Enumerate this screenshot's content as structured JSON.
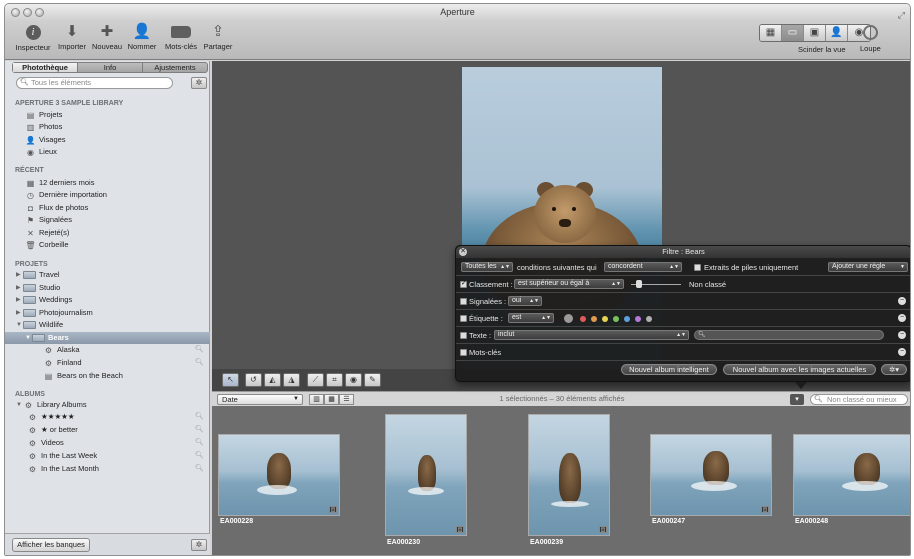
{
  "window": {
    "title": "Aperture"
  },
  "toolbar": {
    "items": [
      {
        "label": "Inspecteur",
        "icon": "info-icon"
      },
      {
        "label": "Importer",
        "icon": "import-arrow-icon"
      },
      {
        "label": "Nouveau",
        "icon": "plus-icon"
      },
      {
        "label": "Nommer",
        "icon": "person-icon"
      },
      {
        "label": "Mots-clés",
        "icon": "tag-icon"
      },
      {
        "label": "Partager",
        "icon": "share-icon"
      }
    ],
    "view_label": "Scinder la vue",
    "loupe_label": "Loupe"
  },
  "sidebar": {
    "tabs": [
      "Photothèque",
      "Info",
      "Ajustements"
    ],
    "active_tab": "Photothèque",
    "search_placeholder": "Tous les éléments",
    "library_header": "APERTURE 3 SAMPLE LIBRARY",
    "library_items": [
      {
        "label": "Projets",
        "icon": "projects-icon"
      },
      {
        "label": "Photos",
        "icon": "photos-icon"
      },
      {
        "label": "Visages",
        "icon": "faces-icon"
      },
      {
        "label": "Lieux",
        "icon": "places-icon"
      }
    ],
    "recent_header": "RÉCENT",
    "recent_items": [
      {
        "label": "12 derniers mois",
        "icon": "calendar-icon"
      },
      {
        "label": "Dernière importation",
        "icon": "clock-icon"
      },
      {
        "label": "Flux de photos",
        "icon": "photostream-icon"
      },
      {
        "label": "Signalées",
        "icon": "flag-icon"
      },
      {
        "label": "Rejeté(s)",
        "icon": "x-icon"
      },
      {
        "label": "Corbeille",
        "icon": "trash-icon"
      }
    ],
    "projects_header": "PROJETS",
    "projects": [
      "Travel",
      "Studio",
      "Weddings",
      "Photojournalism",
      "Wildlife"
    ],
    "selected_project": "Bears",
    "sub_items": [
      {
        "label": "Alaska",
        "icon": "smart-album-icon"
      },
      {
        "label": "Finland",
        "icon": "smart-album-icon"
      },
      {
        "label": "Bears on the Beach",
        "icon": "book-icon"
      }
    ],
    "albums_header": "ALBUMS",
    "library_albums_label": "Library Albums",
    "albums": [
      "★★★★★",
      "★ or better",
      "Videos",
      "In the Last Week",
      "In the Last Month"
    ],
    "banks_button": "Afficher les banques"
  },
  "browser": {
    "sort": "Date",
    "status": "1 sélectionnés – 30 éléments affichés",
    "filter_placeholder": "Non classé ou mieux",
    "thumbnails": [
      {
        "caption": "EA000228"
      },
      {
        "caption": "EA000230"
      },
      {
        "caption": "EA000239"
      },
      {
        "caption": "EA000247"
      },
      {
        "caption": "EA000248"
      }
    ]
  },
  "filter_hud": {
    "title": "Filtre : Bears",
    "match_all": "Toutes les",
    "conditions_text": "conditions suivantes qui",
    "match_mode": "concordent",
    "stack_picks_label": "Extraits de piles uniquement",
    "add_rule": "Ajouter une règle",
    "rating_label": "Classement :",
    "rating_op": "est supérieur ou égal à",
    "rating_value": "Non classé",
    "flagged_label": "Signalées :",
    "flagged_value": "oui",
    "label_label": "Étiquette :",
    "label_op": "est",
    "text_label": "Texte :",
    "text_op": "inclut",
    "keywords_label": "Mots-clés",
    "new_smart_album": "Nouvel album intelligent",
    "new_album_current": "Nouvel album avec les images actuelles",
    "label_colors": [
      "#9a9a9a",
      "#e05a5a",
      "#e39a4f",
      "#e5d352",
      "#78c25d",
      "#5fa0e0",
      "#b57ad6",
      "#b0b0b0"
    ]
  }
}
